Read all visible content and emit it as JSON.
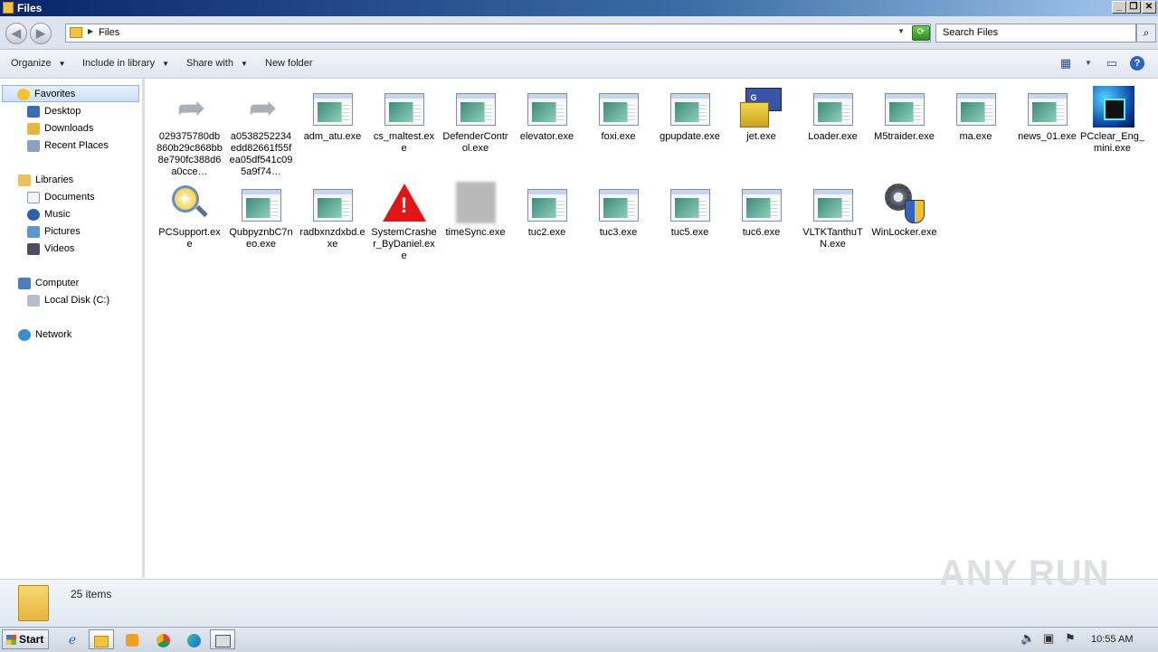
{
  "window": {
    "title": "Files",
    "buttons": {
      "minimize": "_",
      "maximize": "❐",
      "close": "✕"
    }
  },
  "address": {
    "path": "Files",
    "search_placeholder": "Search Files"
  },
  "toolbar": {
    "organize": "Organize",
    "include_in_library": "Include in library",
    "share_with": "Share with",
    "new_folder": "New folder"
  },
  "nav": {
    "favorites": "Favorites",
    "desktop": "Desktop",
    "downloads": "Downloads",
    "recent_places": "Recent Places",
    "libraries": "Libraries",
    "documents": "Documents",
    "music": "Music",
    "pictures": "Pictures",
    "videos": "Videos",
    "computer": "Computer",
    "local_disk": "Local Disk (C:)",
    "network": "Network"
  },
  "files": [
    {
      "name": "029375780db860b29c868bb8e790fc388d6a0cce…",
      "icon": "shortcut-arrow-icon"
    },
    {
      "name": "a0538252234edd82661f55fea05df541c095a9f74…",
      "icon": "shortcut-arrow-icon"
    },
    {
      "name": "adm_atu.exe",
      "icon": "app-window-icon"
    },
    {
      "name": "cs_maltest.exe",
      "icon": "app-window-icon"
    },
    {
      "name": "DefenderControl.exe",
      "icon": "app-window-icon"
    },
    {
      "name": "elevator.exe",
      "icon": "app-window-icon"
    },
    {
      "name": "foxi.exe",
      "icon": "app-window-icon"
    },
    {
      "name": "gpupdate.exe",
      "icon": "app-window-icon"
    },
    {
      "name": "jet.exe",
      "icon": "installer-box-icon"
    },
    {
      "name": "Loader.exe",
      "icon": "app-window-icon"
    },
    {
      "name": "M5traider.exe",
      "icon": "app-window-icon"
    },
    {
      "name": "ma.exe",
      "icon": "app-window-icon"
    },
    {
      "name": "news_01.exe",
      "icon": "app-window-icon"
    },
    {
      "name": "PCclear_Eng_mini.exe",
      "icon": "cubes-icon"
    },
    {
      "name": "PCSupport.exe",
      "icon": "magnifier-plus-icon"
    },
    {
      "name": "QubpyznbC7neo.exe",
      "icon": "app-window-icon"
    },
    {
      "name": "radbxnzdxbd.exe",
      "icon": "app-window-icon"
    },
    {
      "name": "SystemCrasher_ByDaniel.exe",
      "icon": "warning-icon"
    },
    {
      "name": "timeSync.exe",
      "icon": "blurred-app-icon"
    },
    {
      "name": "tuc2.exe",
      "icon": "app-window-icon"
    },
    {
      "name": "tuc3.exe",
      "icon": "app-window-icon"
    },
    {
      "name": "tuc5.exe",
      "icon": "app-window-icon"
    },
    {
      "name": "tuc6.exe",
      "icon": "app-window-icon"
    },
    {
      "name": "VLTKTanthuTN.exe",
      "icon": "app-window-icon"
    },
    {
      "name": "WinLocker.exe",
      "icon": "gear-shield-icon"
    }
  ],
  "status": {
    "count": "25 items"
  },
  "taskbar": {
    "start": "Start",
    "time": "10:55 AM"
  },
  "watermark": "ANY RUN"
}
